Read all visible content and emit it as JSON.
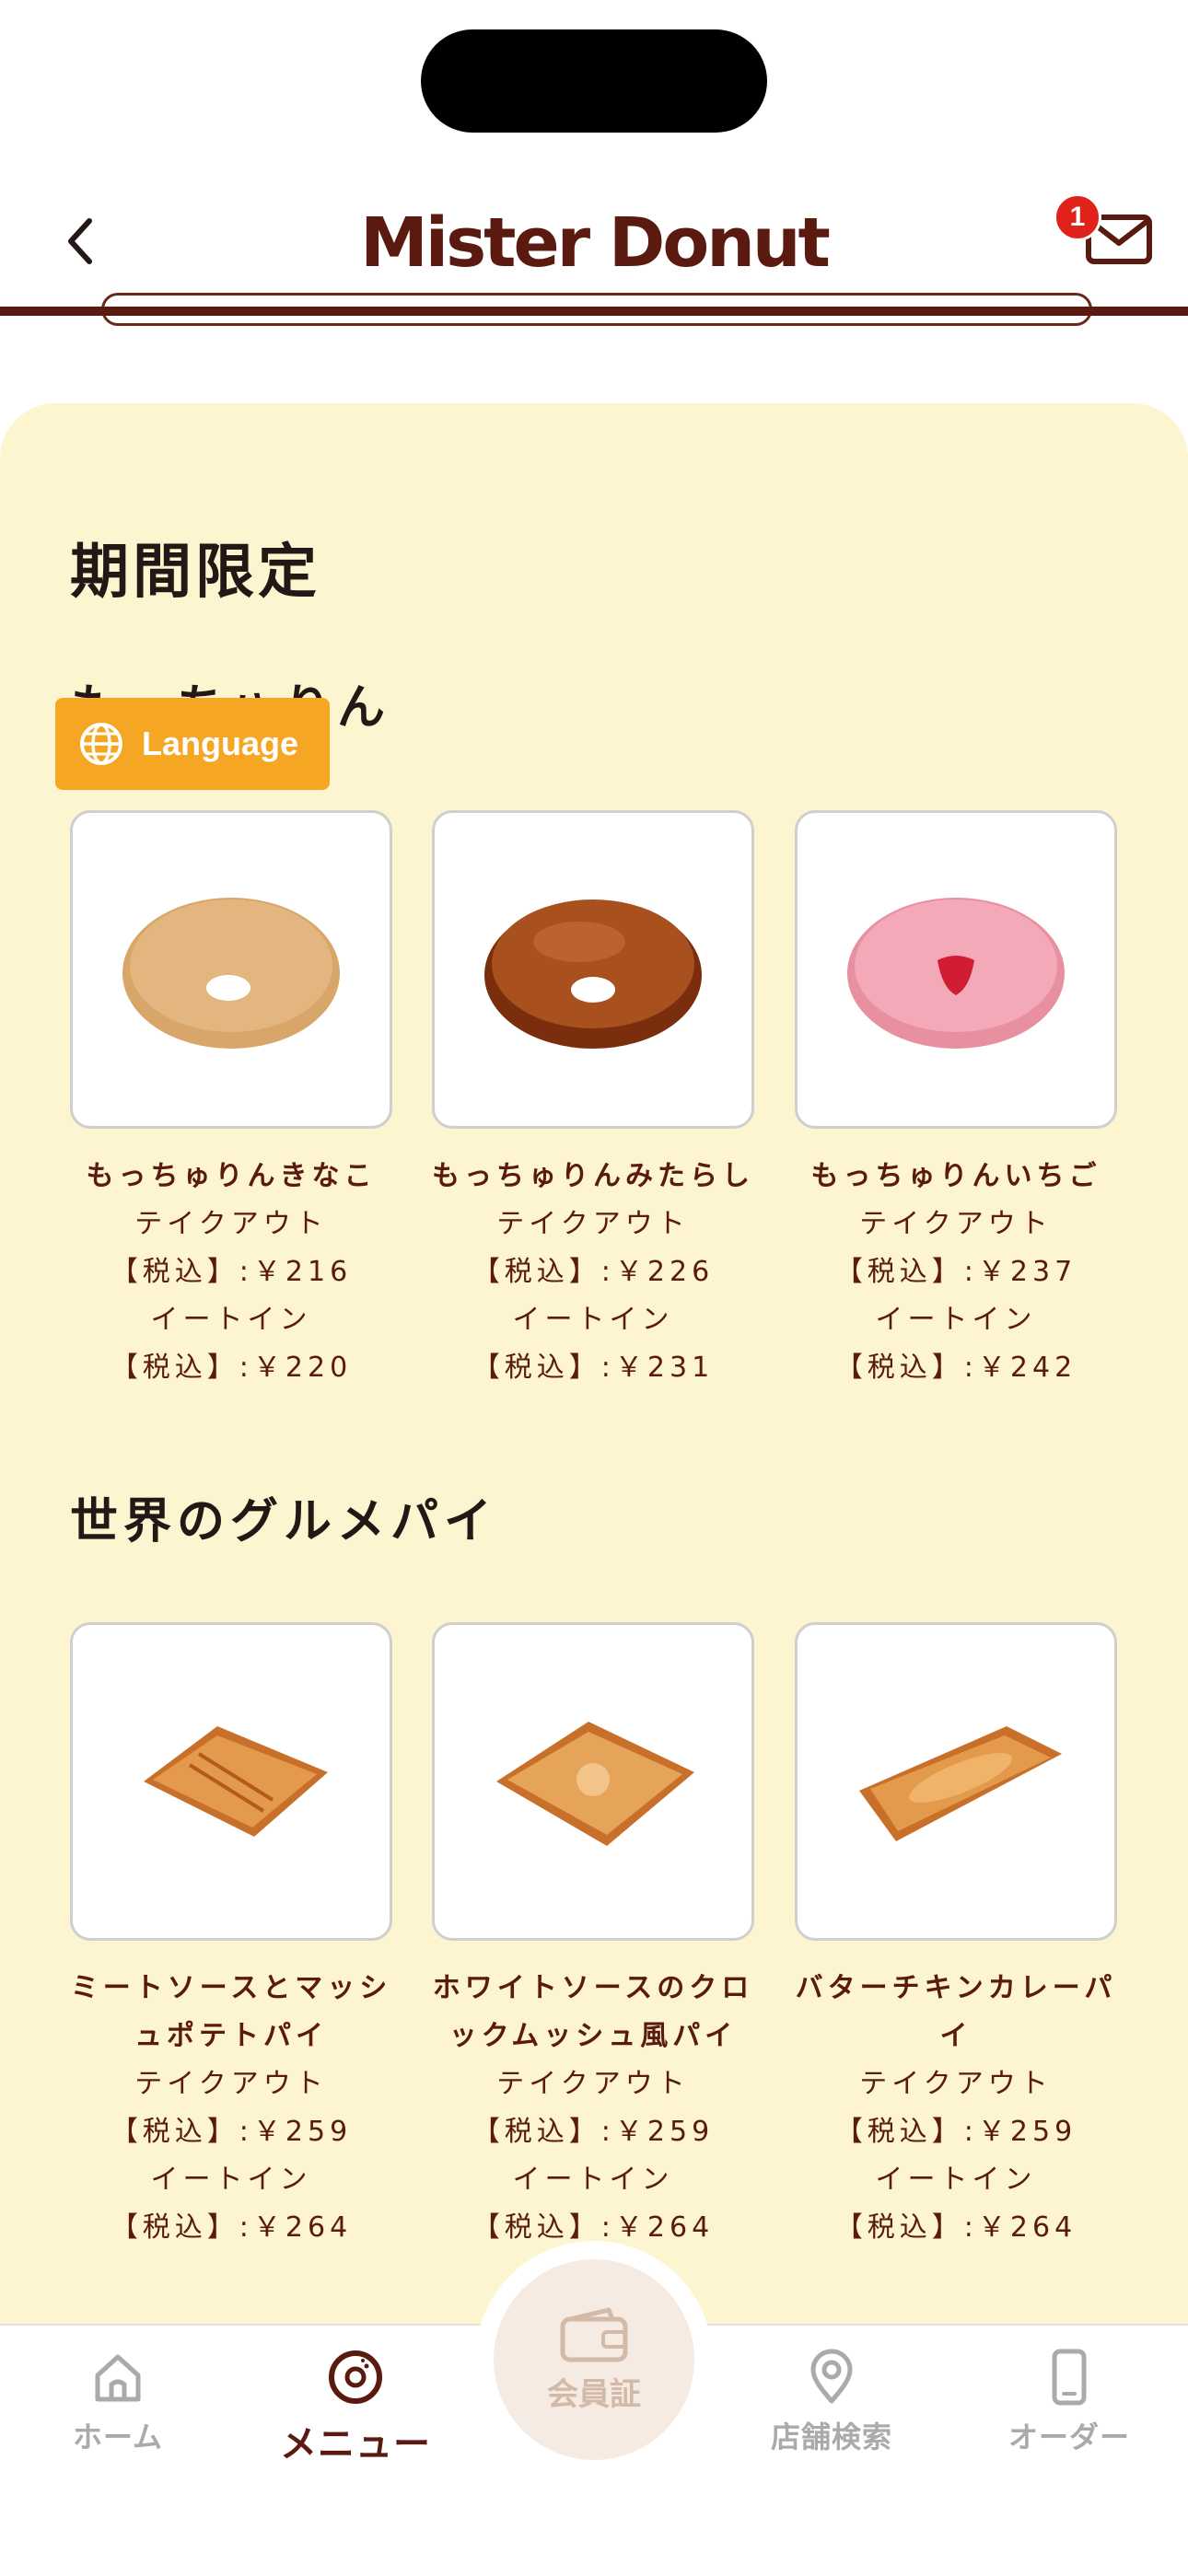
{
  "header": {
    "logo": "Mister Donut",
    "mail_badge_count": "1"
  },
  "language_button": {
    "label": "Language"
  },
  "sections": [
    {
      "title": "期間限定",
      "subtitle": "もっちゅりん",
      "items": [
        {
          "name": [
            "もっちゅりんきなこ"
          ],
          "takeout_label": "テイクアウト",
          "takeout_price": "【税込】:￥216",
          "eatin_label": "イートイン",
          "eatin_price": "【税込】:￥220"
        },
        {
          "name": [
            "もっちゅりんみたらし"
          ],
          "takeout_label": "テイクアウト",
          "takeout_price": "【税込】:￥226",
          "eatin_label": "イートイン",
          "eatin_price": "【税込】:￥231"
        },
        {
          "name": [
            "もっちゅりんいちご"
          ],
          "takeout_label": "テイクアウト",
          "takeout_price": "【税込】:￥237",
          "eatin_label": "イートイン",
          "eatin_price": "【税込】:￥242"
        }
      ]
    },
    {
      "title": "世界のグルメパイ",
      "items": [
        {
          "name": [
            "ミートソースとマッシ",
            "ュポテトパイ"
          ],
          "takeout_label": "テイクアウト",
          "takeout_price": "【税込】:￥259",
          "eatin_label": "イートイン",
          "eatin_price": "【税込】:￥264"
        },
        {
          "name": [
            "ホワイトソースのクロ",
            "ックムッシュ風パイ"
          ],
          "takeout_label": "テイクアウト",
          "takeout_price": "【税込】:￥259",
          "eatin_label": "イートイン",
          "eatin_price": "【税込】:￥264"
        },
        {
          "name": [
            "バターチキンカレーパ",
            "イ"
          ],
          "takeout_label": "テイクアウト",
          "takeout_price": "【税込】:￥259",
          "eatin_label": "イートイン",
          "eatin_price": "【税込】:￥264"
        }
      ]
    }
  ],
  "tabbar": {
    "home": "ホーム",
    "menu": "メニュー",
    "member": "会員証",
    "store_search": "店舗検索",
    "order": "オーダー",
    "active": "menu"
  },
  "colors": {
    "brand_brown": "#5a1a0f",
    "content_bg": "#fcf5cf",
    "language_button": "#f5a623",
    "badge_red": "#e0221a",
    "inactive_tab": "#aaaaaa"
  }
}
